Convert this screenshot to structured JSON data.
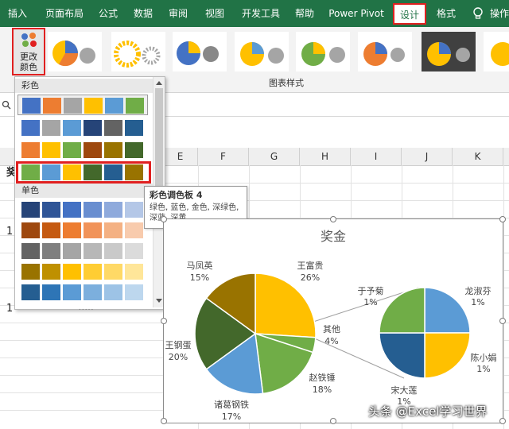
{
  "ribbon": {
    "tabs": [
      "插入",
      "页面布局",
      "公式",
      "数据",
      "审阅",
      "视图",
      "开发工具",
      "帮助",
      "Power Pivot",
      "设计",
      "格式",
      "操作"
    ],
    "active_tab": "设计",
    "change_color_label": [
      "更改",
      "颜色"
    ],
    "group_label": "图表样式"
  },
  "sheet": {
    "columns": [
      "E",
      "F",
      "G",
      "H",
      "I",
      "J",
      "K"
    ],
    "row_texts": [
      "奖",
      "1",
      "1"
    ]
  },
  "dropdown": {
    "colorful_header": "彩色",
    "mono_header": "单色",
    "colorful_palettes": [
      [
        "#4472c4",
        "#ed7d31",
        "#a5a5a5",
        "#ffc000",
        "#5b9bd5",
        "#70ad47"
      ],
      [
        "#4472c4",
        "#a5a5a5",
        "#5b9bd5",
        "#264478",
        "#636363",
        "#255e91"
      ],
      [
        "#ed7d31",
        "#ffc000",
        "#70ad47",
        "#9e480e",
        "#997300",
        "#43682b"
      ],
      [
        "#70ad47",
        "#5b9bd5",
        "#ffc000",
        "#43682b",
        "#255e91",
        "#997300"
      ]
    ],
    "mono_palettes": [
      [
        "#264478",
        "#2f5597",
        "#4472c4",
        "#698ed0",
        "#8faadc",
        "#b4c7e7"
      ],
      [
        "#9e480e",
        "#c55a11",
        "#ed7d31",
        "#f19359",
        "#f4b183",
        "#f8cbad"
      ],
      [
        "#636363",
        "#7f7f7f",
        "#a5a5a5",
        "#b7b7b7",
        "#c9c9c9",
        "#dbdbdb"
      ],
      [
        "#997300",
        "#bf9000",
        "#ffc000",
        "#ffcd33",
        "#ffd966",
        "#ffe699"
      ],
      [
        "#255e91",
        "#2e75b6",
        "#5b9bd5",
        "#7cafdd",
        "#9dc3e6",
        "#bdd7ee"
      ]
    ],
    "more_dots": "....."
  },
  "tooltip": {
    "title": "彩色调色板 4",
    "description": "绿色, 蓝色, 金色, 深绿色, 深蓝, 深黄"
  },
  "chart": {
    "title": "奖金",
    "main_labels": [
      {
        "name": "马凤英",
        "pct": "15%"
      },
      {
        "name": "王富贵",
        "pct": "26%"
      },
      {
        "name": "其他",
        "pct": "4%"
      },
      {
        "name": "王钢蛋",
        "pct": "20%"
      },
      {
        "name": "赵铁锤",
        "pct": "18%"
      },
      {
        "name": "诸葛钢铁",
        "pct": "17%"
      }
    ],
    "sub_labels": [
      {
        "name": "于予菊",
        "pct": "1%"
      },
      {
        "name": "龙淑芬",
        "pct": "1%"
      },
      {
        "name": "陈小娟",
        "pct": "1%"
      },
      {
        "name": "宋大莲",
        "pct": "1%"
      }
    ]
  },
  "chart_data": {
    "type": "pie",
    "title": "奖金",
    "main_pie": {
      "categories": [
        "王富贵",
        "其他",
        "赵铁锤",
        "诸葛钢铁",
        "王钢蛋",
        "马凤英"
      ],
      "values": [
        26,
        4,
        18,
        17,
        20,
        15
      ],
      "colors": [
        "#ffc000",
        "#70ad47",
        "#70ad47",
        "#5b9bd5",
        "#43682b",
        "#997300"
      ]
    },
    "secondary_pie": {
      "categories": [
        "龙淑芬",
        "陈小娟",
        "宋大莲",
        "于予菊"
      ],
      "values": [
        1,
        1,
        1,
        1
      ],
      "colors": [
        "#5b9bd5",
        "#ffc000",
        "#255e91",
        "#70ad47"
      ]
    }
  },
  "watermark": "头条 @Excel学习世界"
}
